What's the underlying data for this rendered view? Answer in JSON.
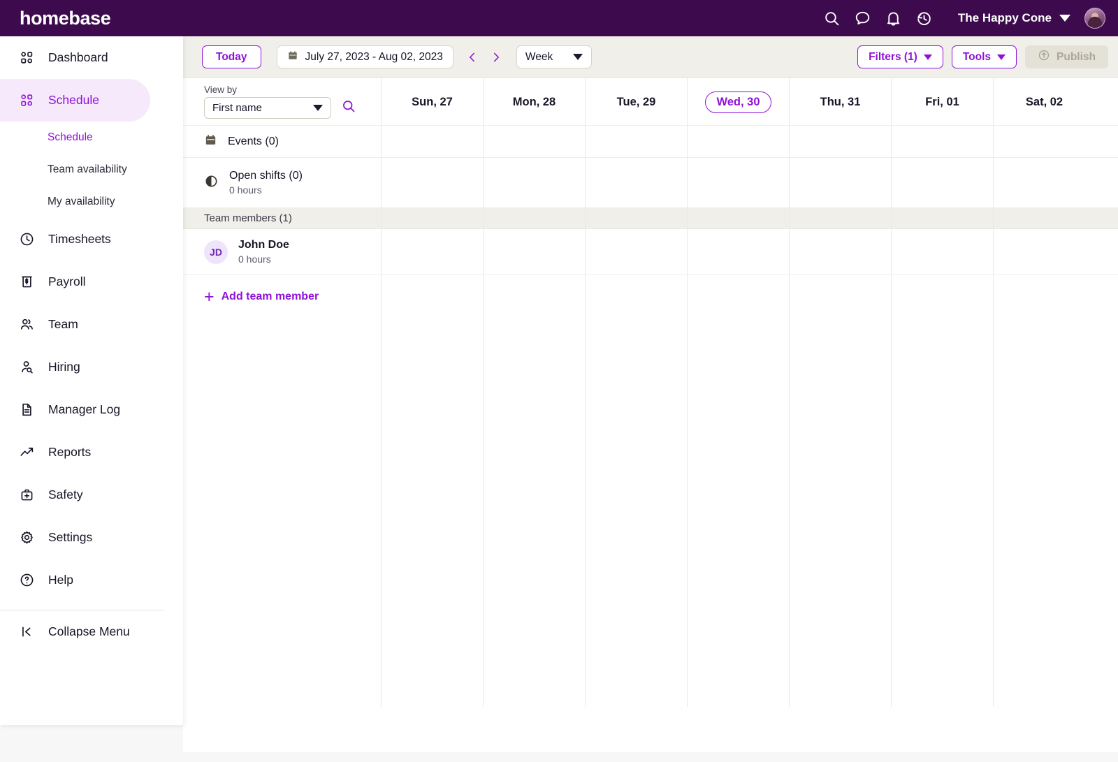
{
  "brand": {
    "name": "homebase",
    "accent": "#9012d8",
    "header_bg": "#3d0b4d"
  },
  "topbar": {
    "icons": [
      {
        "name": "search-icon",
        "label": "Search"
      },
      {
        "name": "chat-icon",
        "label": "Messages"
      },
      {
        "name": "bell-icon",
        "label": "Notifications"
      },
      {
        "name": "history-icon",
        "label": "Activity history"
      }
    ],
    "company": "The Happy Cone",
    "avatar_alt": "User profile"
  },
  "sidebar": {
    "items": [
      {
        "icon": "grid-icon",
        "label": "Dashboard",
        "active": false
      },
      {
        "icon": "grid-icon",
        "label": "Schedule",
        "active": true
      },
      {
        "icon": "clock-icon",
        "label": "Timesheets",
        "active": false
      },
      {
        "icon": "dollar-bill-icon",
        "label": "Payroll",
        "active": false
      },
      {
        "icon": "people-icon",
        "label": "Team",
        "active": false
      },
      {
        "icon": "person-search-icon",
        "label": "Hiring",
        "active": false
      },
      {
        "icon": "document-icon",
        "label": "Manager Log",
        "active": false
      },
      {
        "icon": "trending-up-icon",
        "label": "Reports",
        "active": false
      },
      {
        "icon": "first-aid-icon",
        "label": "Safety",
        "active": false
      },
      {
        "icon": "gear-icon",
        "label": "Settings",
        "active": false
      },
      {
        "icon": "question-circle-icon",
        "label": "Help",
        "active": false
      }
    ],
    "subitems": [
      {
        "label": "Schedule",
        "active": true
      },
      {
        "label": "Team availability",
        "active": false
      },
      {
        "label": "My availability",
        "active": false
      }
    ],
    "collapse": {
      "icon": "collapse-left-icon",
      "label": "Collapse Menu"
    }
  },
  "toolbar": {
    "today_label": "Today",
    "date_range": "July 27, 2023 - Aug 02, 2023",
    "calendar_icon": "calendar-icon",
    "prev_icon": "chevron-left-icon",
    "next_icon": "chevron-right-icon",
    "view_period": "Week",
    "filters_label": "Filters (1)",
    "tools_label": "Tools",
    "publish_label": "Publish",
    "publish_icon": "upload-icon",
    "publish_disabled": true
  },
  "schedule": {
    "view_by_label": "View by",
    "view_by_value": "First name",
    "search_icon": "search-icon",
    "days": [
      {
        "label": "Sun, 27",
        "today": false
      },
      {
        "label": "Mon, 28",
        "today": false
      },
      {
        "label": "Tue, 29",
        "today": false
      },
      {
        "label": "Wed, 30",
        "today": true
      },
      {
        "label": "Thu, 31",
        "today": false
      },
      {
        "label": "Fri, 01",
        "today": false
      },
      {
        "label": "Sat, 02",
        "today": false
      }
    ],
    "events_row": {
      "icon": "calendar-filled-icon",
      "label": "Events (0)"
    },
    "open_shifts_row": {
      "icon": "half-circle-icon",
      "label": "Open shifts (0)",
      "sub": "0 hours"
    },
    "team_members_header": "Team members (1)",
    "members": [
      {
        "initials": "JD",
        "name": "John Doe",
        "hours": "0 hours"
      }
    ],
    "add_member_label": "Add team member",
    "add_member_icon": "plus-icon"
  }
}
